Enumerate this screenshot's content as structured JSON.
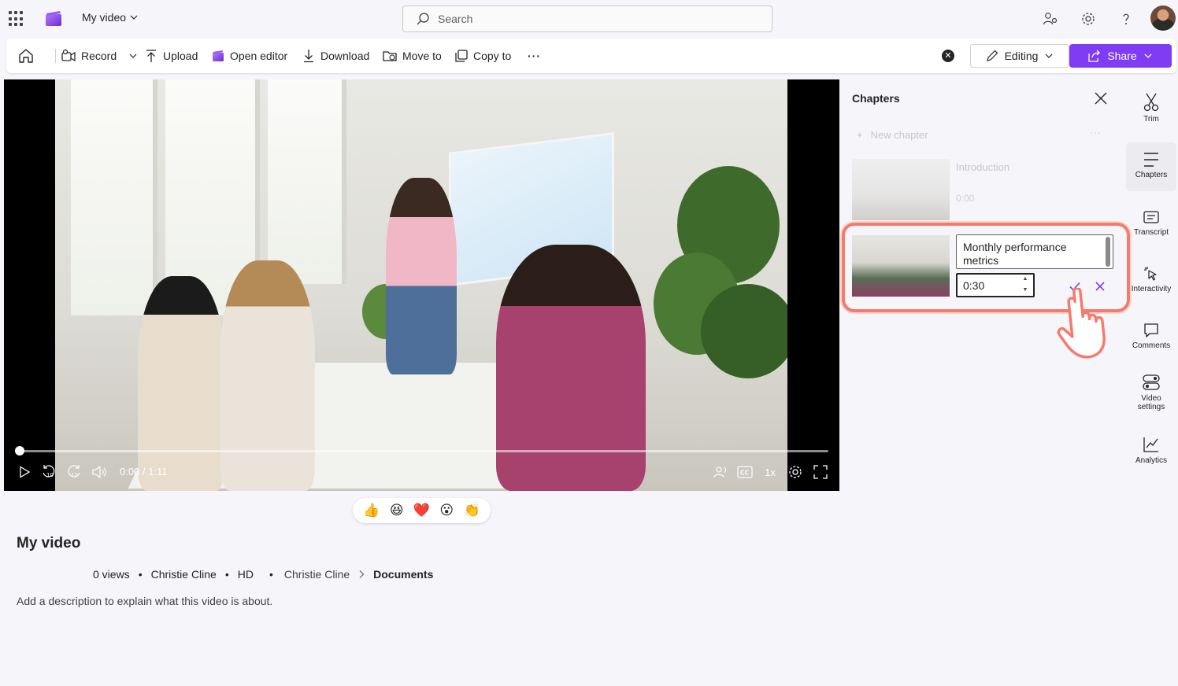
{
  "header": {
    "app_launcher_icon": "waffle-icon",
    "app_logo_icon": "clipchamp-logo",
    "title": "My video",
    "search": {
      "placeholder": "Search",
      "value": ""
    },
    "icons": [
      "people-settings-icon",
      "gear-icon",
      "help-icon",
      "avatar"
    ]
  },
  "toolbar": {
    "home_icon": "home-icon",
    "record": "Record",
    "upload": "Upload",
    "open_editor": "Open editor",
    "download": "Download",
    "move_to": "Move to",
    "copy_to": "Copy to",
    "more": "···",
    "editing": "Editing",
    "share": "Share"
  },
  "player": {
    "time": "0:00 / 1:11",
    "speed": "1x",
    "controls": [
      "play-icon",
      "rewind-10-icon",
      "forward-10-icon",
      "volume-icon",
      "live-captions-icon",
      "cc-icon",
      "settings-icon",
      "fullscreen-icon"
    ],
    "progress": 0
  },
  "reactions": [
    "👍",
    "😆",
    "❤️",
    "😮",
    "👏"
  ],
  "video_info": {
    "title": "My video",
    "views": "0 views",
    "owner": "Christie Cline",
    "quality": "HD",
    "location_owner": "Christie Cline",
    "location_folder": "Documents",
    "description_placeholder": "Add a description to explain what this video is about."
  },
  "chapters_panel": {
    "title": "Chapters",
    "new_chapter": "New chapter",
    "more": "···",
    "chapters": [
      {
        "name": "Introduction",
        "time": "0:00"
      }
    ],
    "editing_chapter": {
      "title_line1": "Monthly performance",
      "title_line2": "metrics",
      "time_value": "0:30"
    }
  },
  "rail": {
    "trim": "Trim",
    "chapters": "Chapters",
    "transcript": "Transcript",
    "interactivity": "Interactivity",
    "comments": "Comments",
    "video_settings_1": "Video",
    "video_settings_2": "settings",
    "analytics": "Analytics"
  },
  "colors": {
    "accent": "#7f3cf2",
    "highlight": "#f47b6d",
    "background": "#f5f5fa"
  }
}
